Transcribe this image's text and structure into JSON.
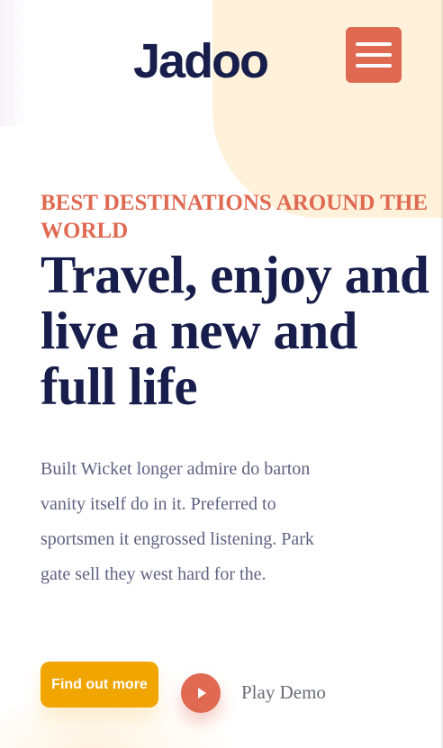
{
  "brand": {
    "logo_text": "Jadoo"
  },
  "header": {
    "menu_icon": "hamburger-menu-icon"
  },
  "hero": {
    "eyebrow": "Best Destinations around the world",
    "headline": "Travel, enjoy and live a new and full life",
    "description": "Built Wicket longer admire do barton vanity itself do in it. Preferred to sportsmen it engrossed listening. Park gate sell they west hard for the.",
    "cta_label": "Find out more",
    "play_icon": "play-icon",
    "play_label": "Play Demo"
  },
  "colors": {
    "accent": "#df6951",
    "cta": "#f1a501",
    "heading": "#181e4b",
    "body_text": "#5e6282",
    "blob": "#fff1da"
  }
}
